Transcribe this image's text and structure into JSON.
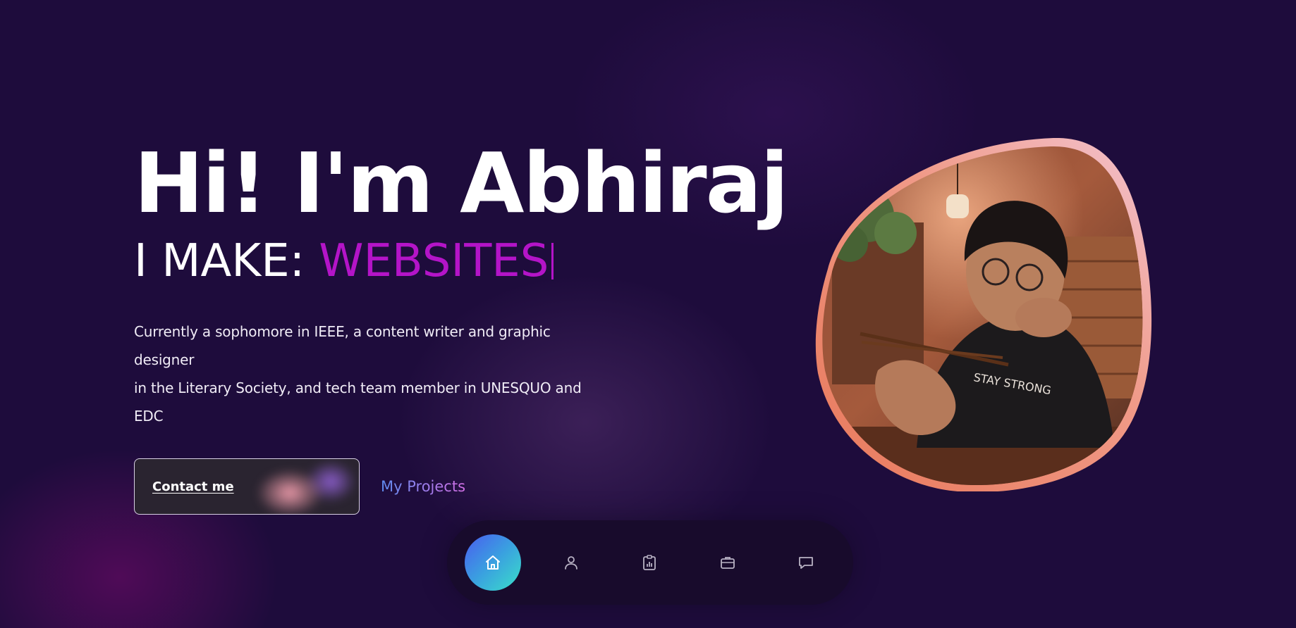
{
  "hero": {
    "greeting": "Hi! I'm Abhiraj",
    "make_label": "I MAKE:",
    "make_word": "WEBSITES",
    "bio_lines": [
      "Currently a sophomore in IEEE, a content writer and graphic designer",
      "in the Literary Society, and tech team member in UNESQUO and EDC"
    ]
  },
  "actions": {
    "contact_label": "Contact me",
    "projects_label": "My Projects"
  },
  "portrait": {
    "subject": "person at a wooden table holding chopsticks, wearing a black t-shirt with \"STAY STRONG\" print"
  },
  "nav": {
    "items": [
      {
        "icon": "home-icon",
        "active": true
      },
      {
        "icon": "user-icon",
        "active": false
      },
      {
        "icon": "clipboard-chart-icon",
        "active": false
      },
      {
        "icon": "briefcase-icon",
        "active": false
      },
      {
        "icon": "chat-bubble-icon",
        "active": false
      }
    ]
  },
  "colors": {
    "background": "#1e0c3c",
    "accent_magenta": "#b414c8",
    "portrait_border_start": "#e8785a",
    "portrait_border_end": "#f0b8c8",
    "nav_active_start": "#4a5cf0",
    "nav_active_end": "#39e0c8"
  }
}
